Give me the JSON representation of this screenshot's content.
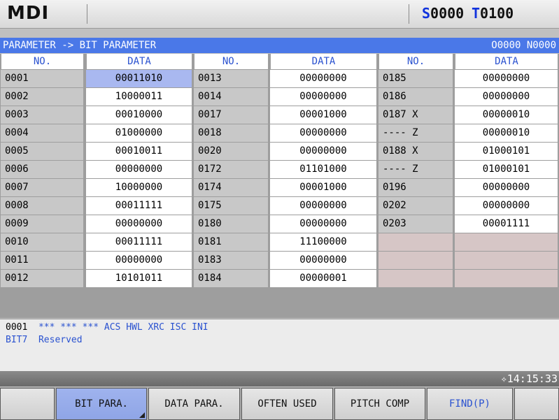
{
  "top": {
    "mode": "MDI",
    "spindle_label": "S",
    "spindle_value": "0000",
    "tool_label": "T",
    "tool_value": "0100"
  },
  "title": {
    "path": "PARAMETER -> BIT PARAMETER",
    "program": "O0000 N0000"
  },
  "headers": [
    "NO.",
    "DATA",
    "NO.",
    "DATA",
    "NO.",
    "DATA"
  ],
  "columns": [
    [
      [
        "0001",
        "00011010"
      ],
      [
        "0002",
        "10000011"
      ],
      [
        "0003",
        "00010000"
      ],
      [
        "0004",
        "01000000"
      ],
      [
        "0005",
        "00010011"
      ],
      [
        "0006",
        "00000000"
      ],
      [
        "0007",
        "10000000"
      ],
      [
        "0008",
        "00011111"
      ],
      [
        "0009",
        "00000000"
      ],
      [
        "0010",
        "00011111"
      ],
      [
        "0011",
        "00000000"
      ],
      [
        "0012",
        "10101011"
      ]
    ],
    [
      [
        "0013",
        "00000000"
      ],
      [
        "0014",
        "00000000"
      ],
      [
        "0017",
        "00001000"
      ],
      [
        "0018",
        "00000000"
      ],
      [
        "0020",
        "00000000"
      ],
      [
        "0172",
        "01101000"
      ],
      [
        "0174",
        "00001000"
      ],
      [
        "0175",
        "00000000"
      ],
      [
        "0180",
        "00000000"
      ],
      [
        "0181",
        "11100000"
      ],
      [
        "0183",
        "00000000"
      ],
      [
        "0184",
        "00000001"
      ]
    ],
    [
      [
        "0185",
        "00000000"
      ],
      [
        "0186",
        "00000000"
      ],
      [
        "0187 X",
        "00000010"
      ],
      [
        "---- Z",
        "00000010"
      ],
      [
        "0188 X",
        "01000101"
      ],
      [
        "---- Z",
        "01000101"
      ],
      [
        "0196",
        "00000000"
      ],
      [
        "0202",
        "00000000"
      ],
      [
        "0203",
        "00001111"
      ],
      [
        "",
        ""
      ],
      [
        "",
        ""
      ],
      [
        "",
        ""
      ]
    ]
  ],
  "info": {
    "param_no": "0001",
    "bits": "*** *** *** ACS HWL XRC ISC INI",
    "bit_label": "BIT7",
    "bit_desc": "Reserved"
  },
  "clock": "14:15:33",
  "softkeys": [
    "",
    "BIT PARA.",
    "DATA PARA.",
    "OFTEN USED",
    "PITCH COMP",
    "FIND(P)",
    ""
  ]
}
